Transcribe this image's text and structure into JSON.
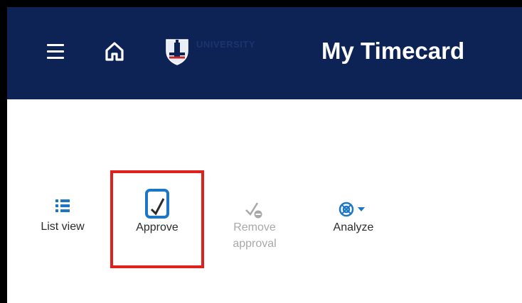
{
  "header": {
    "title": "My Timecard",
    "logo_text": "UNIVERSITY",
    "logo_sub": "",
    "icons": {
      "menu": "hamburger-menu-icon",
      "home": "home-icon",
      "logo": "university-crest-logo"
    }
  },
  "toolbar": {
    "items": [
      {
        "label": "List view",
        "icon": "list-view-icon",
        "enabled": true
      },
      {
        "label": "Approve",
        "icon": "approve-icon",
        "enabled": true,
        "highlighted": true
      },
      {
        "label_line1": "Remove",
        "label_line2": "approval",
        "icon": "remove-approval-icon",
        "enabled": false
      },
      {
        "label": "Analyze",
        "icon": "analyze-icon",
        "enabled": true,
        "has_dropdown": true
      }
    ]
  },
  "colors": {
    "header_bg": "#0d2356",
    "accent": "#1b76c6",
    "highlight_border": "#e0201b",
    "disabled_text": "#a8a8a8"
  }
}
